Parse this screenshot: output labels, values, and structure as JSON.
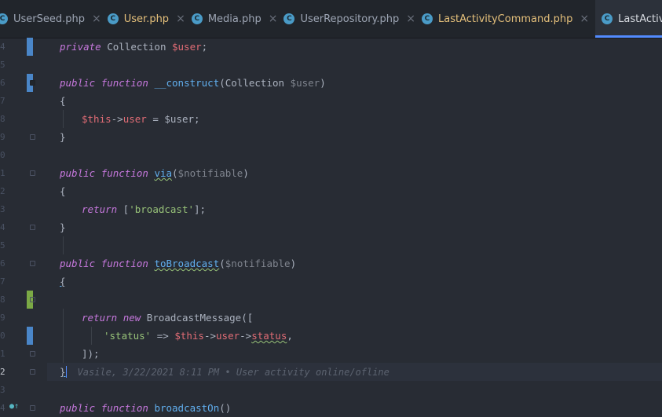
{
  "tabs": [
    {
      "label": "UserSeed.php",
      "icon": "C",
      "state": "normal"
    },
    {
      "label": "User.php",
      "icon": "C",
      "state": "modified"
    },
    {
      "label": "Media.php",
      "icon": "C",
      "state": "normal"
    },
    {
      "label": "UserRepository.php",
      "icon": "C",
      "state": "normal"
    },
    {
      "label": "LastActivityCommand.php",
      "icon": "C",
      "state": "modified"
    },
    {
      "label": "LastActivityNotification.php",
      "icon": "C",
      "state": "active"
    }
  ],
  "close_glyph": "×",
  "gutter": {
    "line_numbers": [
      "4",
      "5",
      "6",
      "7",
      "8",
      "9",
      "0",
      "1",
      "2",
      "3",
      "4",
      "5",
      "6",
      "7",
      "8",
      "9",
      "0",
      "1",
      "2",
      "3",
      "4"
    ],
    "current_line_index": 18
  },
  "code": {
    "l0": [
      "private",
      " Collection ",
      "$user",
      ";"
    ],
    "l2": [
      "public",
      " ",
      "function",
      " ",
      "__construct",
      "(Collection ",
      "$user",
      ")"
    ],
    "l3": [
      "{"
    ],
    "l4": [
      "$this",
      "->",
      "user",
      " = ",
      "$user",
      ";"
    ],
    "l5": [
      "}"
    ],
    "l7": [
      "public",
      " ",
      "function",
      " ",
      "via",
      "(",
      "$notifiable",
      ")"
    ],
    "l8": [
      "{"
    ],
    "l9": [
      "return",
      " [",
      "'broadcast'",
      "];"
    ],
    "l10": [
      "}"
    ],
    "l12": [
      "public",
      " ",
      "function",
      " ",
      "toBroadcast",
      "(",
      "$notifiable",
      ")"
    ],
    "l13": [
      "{"
    ],
    "l15": [
      "return",
      " ",
      "new",
      " BroadcastMessage(["
    ],
    "l16": [
      "'status'",
      " => ",
      "$this",
      "->",
      "user",
      "->",
      "status",
      ","
    ],
    "l17": [
      "]);"
    ],
    "l18": [
      "}"
    ],
    "l20": [
      "public",
      " ",
      "function",
      " ",
      "broadcastOn",
      "()"
    ]
  },
  "blame": "Vasile, 3/22/2021 8:11 PM • User activity online/ofline",
  "colors": {
    "background": "#282c34",
    "keyword": "#c678dd",
    "function": "#61afef",
    "variable": "#e06c75",
    "string": "#98c379",
    "vcs_modified": "#4a86c8",
    "vcs_added": "#7ba945",
    "active_tab_underline": "#528bff"
  },
  "icons": [
    "php-class-icon",
    "close-icon",
    "fold-marker-icon",
    "implements-icon"
  ]
}
